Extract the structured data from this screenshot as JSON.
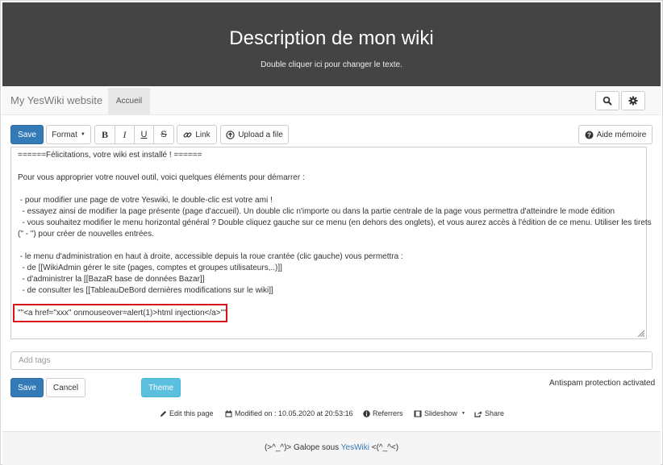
{
  "banner": {
    "title": "Description de mon wiki",
    "subtitle": "Double cliquer ici pour changer le texte."
  },
  "navbar": {
    "brand": "My YesWiki website",
    "tab_home": "Accueil",
    "search_icon": "search-icon",
    "settings_icon": "gear-icon"
  },
  "toolbar": {
    "save_label": "Save",
    "format_label": "Format",
    "bold_label": "B",
    "italic_label": "I",
    "underline_label": "U",
    "strike_label": "S",
    "link_label": "Link",
    "upload_label": "Upload a file",
    "help_label": "Aide mémoire"
  },
  "editor": {
    "lines": [
      "======Félicitations, votre wiki est installé ! ======",
      "",
      "Pour vous approprier votre nouvel outil, voici quelques éléments pour démarrer :",
      "",
      " - pour modifier une page de votre Yeswiki, le double-clic est votre ami !",
      "  - essayez ainsi de modifier la page présente (page d'accueil). Un double clic n'importe ou dans la partie centrale de la page vous permettra d'atteindre le mode édition",
      "  - vous souhaitez modifier le menu horizontal général ? Double cliquez gauche sur ce menu (en dehors des onglets), et vous aurez accès à l'édition de ce menu. Utiliser les tirets",
      "(\" - \") pour créer de nouvelles entrées.",
      "",
      " - le menu d'administration en haut à droite, accessible depuis la roue crantée (clic gauche) vous permettra :",
      "  - de [[WikiAdmin gérer le site (pages, comptes et groupes utilisateurs,..)]]",
      "  - d'administrer la [[BazaR base de données Bazar]]",
      "  - de consulter les [[TableauDeBord dernières modifications sur le wiki]]",
      "",
      "\"\"<a href=\"xxx\" onmouseover=alert(1)>html injection</a>\"\""
    ]
  },
  "form": {
    "tags_placeholder": "Add tags",
    "save_label": "Save",
    "cancel_label": "Cancel",
    "theme_label": "Theme",
    "antispam": "Antispam protection activated"
  },
  "meta": {
    "edit": "Edit this page",
    "modified": "Modified on : 10.05.2020 at 20:53:16",
    "referrers": "Referrers",
    "slideshow": "Slideshow",
    "share": "Share"
  },
  "footer": {
    "prefix": "(>^_^)> Galope sous ",
    "link": "YesWiki",
    "suffix": " <(^_^<)"
  },
  "colors": {
    "banner_bg": "#444444",
    "primary": "#337ab7",
    "info": "#5bc0de",
    "highlight": "#d9151b"
  }
}
